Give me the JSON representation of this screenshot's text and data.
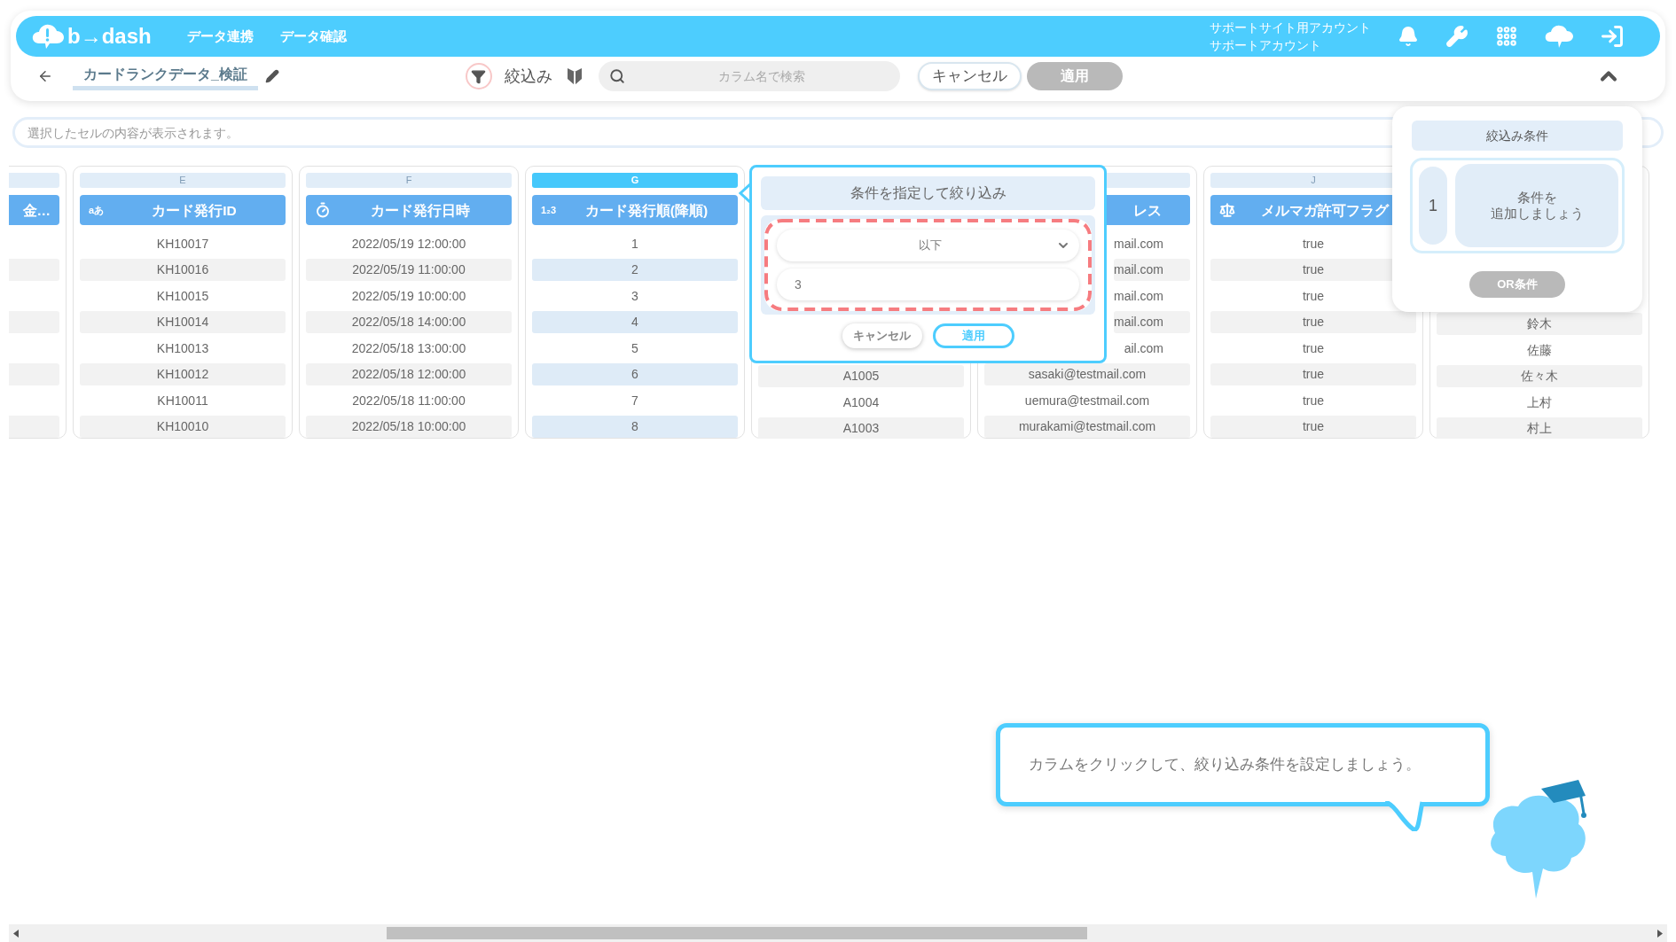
{
  "app": {
    "logo": "b→dash",
    "nav": [
      {
        "label": "データ連携"
      },
      {
        "label": "データ確認"
      }
    ],
    "account": [
      "サポートサイト用アカウント",
      "サポートアカウント"
    ]
  },
  "toolbar": {
    "title": "カードランクデータ_検証",
    "filter_label": "絞込み",
    "search": {
      "placeholder": "カラム名で検索"
    },
    "cancel": "キャンセル",
    "apply": {
      "label": "適用",
      "disabled": true
    }
  },
  "cell_preview": {
    "placeholder": "選択したセルの内容が表示されます。"
  },
  "columns": [
    {
      "header": "金…",
      "selected": false
    },
    {
      "letter": "E",
      "kind": "text",
      "type_label": "aあ",
      "header": "カード発行ID",
      "selected": false,
      "rows": [
        {
          "text": "KH10017"
        },
        {
          "text": "KH10016"
        },
        {
          "text": "KH10015"
        },
        {
          "text": "KH10014"
        },
        {
          "text": "KH10013"
        },
        {
          "text": "KH10012"
        },
        {
          "text": "KH10011"
        },
        {
          "text": "KH10010"
        }
      ]
    },
    {
      "letter": "F",
      "kind": "datetime",
      "header": "カード発行日時",
      "selected": false,
      "rows": [
        {
          "text": "2022/05/19 12:00:00"
        },
        {
          "text": "2022/05/19 11:00:00"
        },
        {
          "text": "2022/05/19 10:00:00"
        },
        {
          "text": "2022/05/18 14:00:00"
        },
        {
          "text": "2022/05/18 13:00:00"
        },
        {
          "text": "2022/05/18 12:00:00"
        },
        {
          "text": "2022/05/18 11:00:00"
        },
        {
          "text": "2022/05/18 10:00:00"
        }
      ]
    },
    {
      "letter": "G",
      "kind": "number",
      "type_label": "1₂3",
      "header": "カード発行順(降順)",
      "selected": true,
      "rows": [
        {
          "text": "1"
        },
        {
          "text": "2"
        },
        {
          "text": "3"
        },
        {
          "text": "4"
        },
        {
          "text": "5"
        },
        {
          "text": "6"
        },
        {
          "text": "7"
        },
        {
          "text": "8"
        }
      ]
    },
    {
      "rows": [
        {
          "text": "A1005"
        },
        {
          "text": "A1004"
        },
        {
          "text": "A1003"
        }
      ]
    },
    {
      "header": "レス",
      "header_partly_hidden": true,
      "selected": false,
      "rows": [
        {
          "text": "mail.com",
          "partly_hidden": true
        },
        {
          "text": "mail.com",
          "partly_hidden": true
        },
        {
          "text": "mail.com",
          "partly_hidden": true
        },
        {
          "text": "mail.com",
          "partly_hidden": true
        },
        {
          "text": "ail.com",
          "partly_hidden": true
        },
        {
          "text": "sasaki@testmail.com"
        },
        {
          "text": "uemura@testmail.com"
        },
        {
          "text": "murakami@testmail.com"
        }
      ]
    },
    {
      "letter": "J",
      "kind": "boolean",
      "header": "メルマガ許可フラグ",
      "selected": false,
      "rows": [
        {
          "text": "true"
        },
        {
          "text": "true"
        },
        {
          "text": "true"
        },
        {
          "text": "true"
        },
        {
          "text": "true"
        },
        {
          "text": "true"
        },
        {
          "text": "true"
        },
        {
          "text": "true"
        }
      ]
    },
    {
      "rows": [
        {
          "text": "鈴木"
        },
        {
          "text": "佐藤"
        },
        {
          "text": "佐々木"
        },
        {
          "text": "上村"
        },
        {
          "text": "村上"
        }
      ]
    }
  ],
  "filter_popover": {
    "title": "条件を指定して絞り込み",
    "operator": "以下",
    "value": "3",
    "cancel": "キャンセル",
    "apply": "適用"
  },
  "conditions_panel": {
    "title": "絞込み条件",
    "groups": [
      {
        "number": "1",
        "hint_lines": [
          "条件を",
          "追加しましょう"
        ]
      }
    ],
    "or_button": {
      "label": "OR条件",
      "disabled": true
    }
  },
  "guide": {
    "message": "カラムをクリックして、絞り込み条件を設定しましょう。"
  }
}
